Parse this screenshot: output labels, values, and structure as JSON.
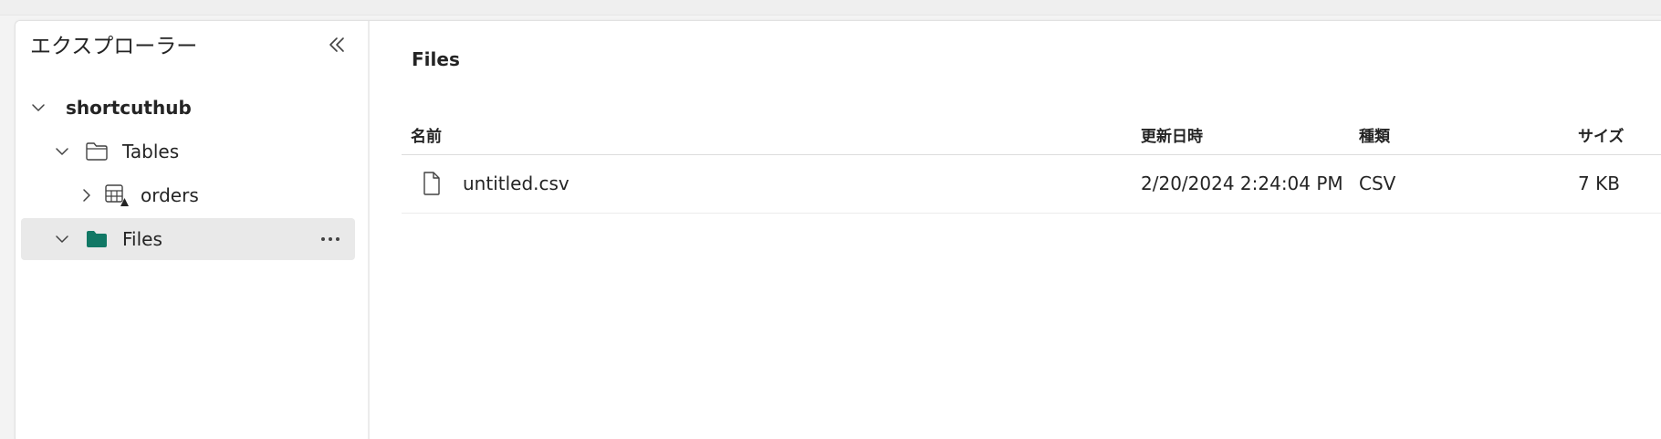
{
  "explorer": {
    "title": "エクスプローラー",
    "collapse_icon": "double-chevron-left-icon",
    "tree": {
      "root": {
        "label": "shortcuthub",
        "expanded": true
      },
      "tables": {
        "label": "Tables",
        "expanded": true
      },
      "orders": {
        "label": "orders",
        "expanded": false
      },
      "files": {
        "label": "Files",
        "expanded": true,
        "selected": true,
        "more_label": "···"
      }
    }
  },
  "content": {
    "title": "Files",
    "columns": {
      "name": "名前",
      "modified": "更新日時",
      "type": "種類",
      "size": "サイズ"
    },
    "rows": [
      {
        "name": "untitled.csv",
        "modified": "2/20/2024 2:24:04 PM",
        "type": "CSV",
        "size": "7 KB"
      }
    ]
  },
  "colors": {
    "folder_accent": "#117865",
    "selected_bg": "#e9e9e9"
  }
}
